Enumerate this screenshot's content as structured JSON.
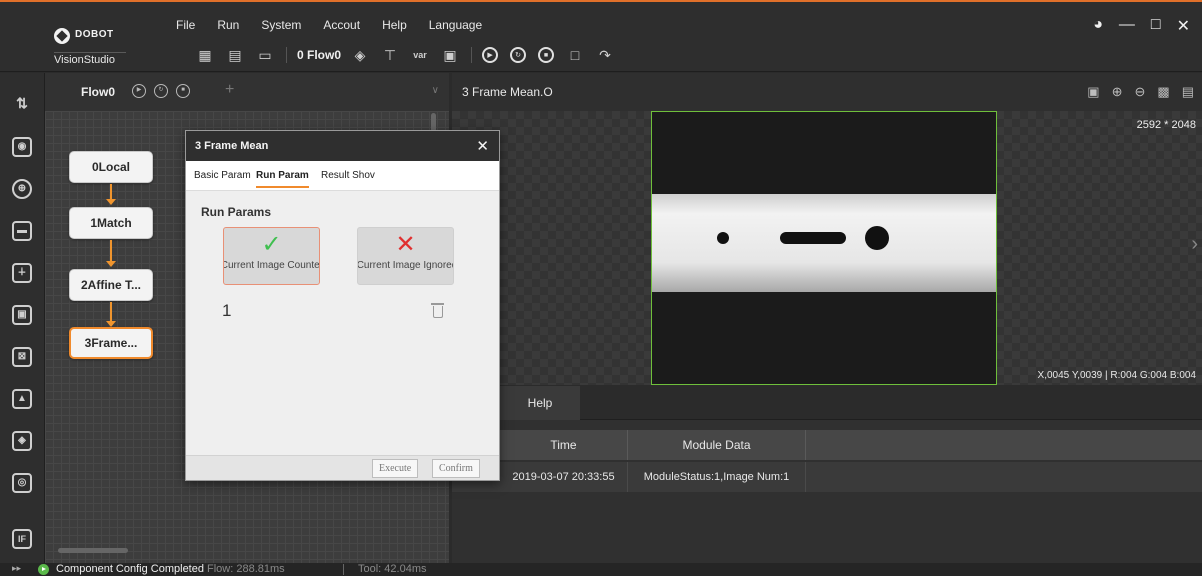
{
  "app": {
    "brand": "DOBOT",
    "product": "VisionStudio",
    "menu": [
      "File",
      "Run",
      "System",
      "Accout",
      "Help",
      "Language"
    ],
    "accent_color": "#f08a2c"
  },
  "toolbar": {
    "flow_selector": "0 Flow0",
    "var_label": "var"
  },
  "flow_panel": {
    "tab_label": "Flow0",
    "nodes": [
      "0Local",
      "1Match",
      "2Affine T...",
      "3Frame..."
    ]
  },
  "image_panel": {
    "tab_label": "3 Frame Mean.O",
    "image_size": "2592 * 2048",
    "pixel_readout": "X,0045  Y,0039  |  R:004  G:004  B:004"
  },
  "result_panel": {
    "tab_label": "Help",
    "columns": [
      "Time",
      "Module Data"
    ],
    "rows": [
      {
        "time": "2019-03-07 20:33:55",
        "module_data": "ModuleStatus:1,Image Num:1"
      }
    ]
  },
  "status_bar": {
    "message": "Component Config Completed",
    "flow_time": "Flow: 288.81ms",
    "tool_time": "Tool: 42.04ms"
  },
  "dialog": {
    "title": "3 Frame Mean",
    "tabs": [
      "Basic Param",
      "Run Param",
      "Result Shov"
    ],
    "active_tab": "Run Param",
    "section_title": "Run Params",
    "option_count": "Current Image Counted",
    "option_ignore": "Current Image Ignored",
    "value": "1",
    "execute_label": "Execute",
    "confirm_label": "Confirm"
  }
}
